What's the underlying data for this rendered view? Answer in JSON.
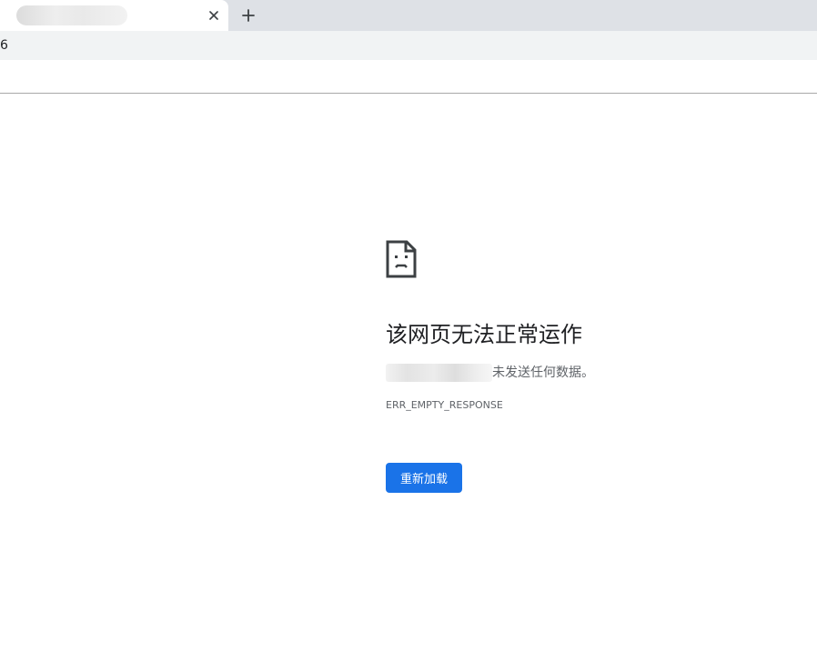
{
  "browser": {
    "tab": {
      "title": "",
      "close_icon": "close-icon"
    },
    "new_tab_icon": "plus-icon",
    "address_bar": {
      "value": "6"
    }
  },
  "error_page": {
    "icon": "sad-page-icon",
    "heading": "该网页无法正常运作",
    "message_suffix": "未发送任何数据。",
    "error_code": "ERR_EMPTY_RESPONSE",
    "reload_button_label": "重新加载"
  },
  "colors": {
    "tabstrip_bg": "#dee1e6",
    "toolbar_bg": "#f1f3f4",
    "primary_button": "#1a73e8",
    "heading_text": "#202124",
    "secondary_text": "#5f6368"
  }
}
